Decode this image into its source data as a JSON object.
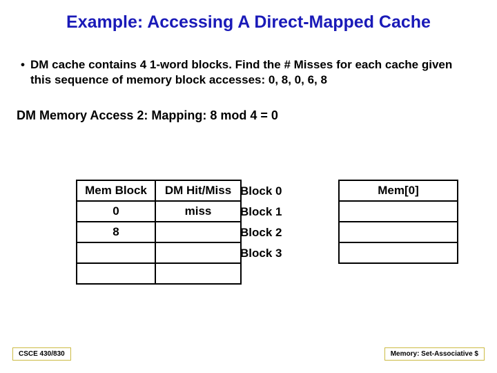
{
  "title": "Example: Accessing A Direct-Mapped Cache",
  "bullet": "DM cache contains 4 1-word blocks. Find the # Misses for each cache given this sequence of memory block accesses: 0, 8, 0, 6, 8",
  "subhead": "DM Memory Access 2:  Mapping: 8 mod 4 = 0",
  "left_table": {
    "h1": "Mem Block",
    "h2": "DM Hit/Miss",
    "r1c1": "0",
    "r1c2": "miss",
    "r2c1": "8",
    "r2c2": "",
    "r3c1": "",
    "r3c2": "",
    "r4c1": "",
    "r4c2": ""
  },
  "block_labels": {
    "b0": "Block 0",
    "b1": "Block 1",
    "b2": "Block 2",
    "b3": "Block 3"
  },
  "right_table": {
    "r0": "Mem[0]",
    "r1": "",
    "r2": "",
    "r3": ""
  },
  "footer_left": "CSCE 430/830",
  "footer_right": "Memory: Set-Associative $"
}
